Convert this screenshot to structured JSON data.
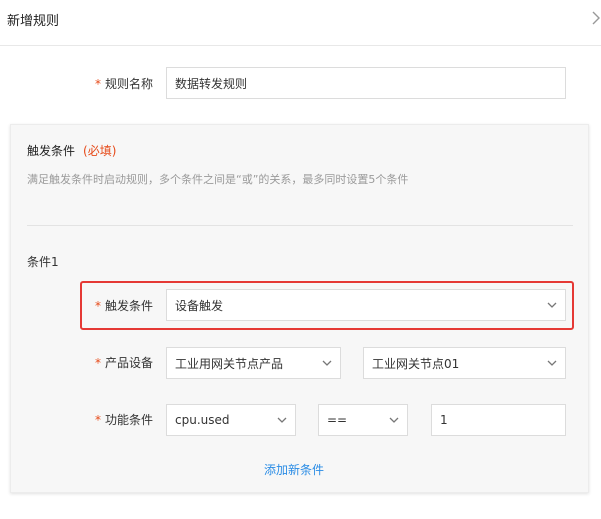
{
  "header": {
    "title": "新增规则"
  },
  "rule_name": {
    "label": "规则名称",
    "value": "数据转发规则",
    "required_mark": "*"
  },
  "trigger_section": {
    "title": "触发条件",
    "required_tag": "(必填)",
    "description": "满足触发条件时启动规则，多个条件之间是“或”的关系，最多同时设置5个条件"
  },
  "condition1": {
    "title": "条件1",
    "trigger": {
      "label": "触发条件",
      "value": "设备触发"
    },
    "product_device": {
      "label": "产品设备",
      "product_value": "工业用网关节点产品",
      "device_value": "工业网关节点01"
    },
    "function": {
      "label": "功能条件",
      "field_value": "cpu.used",
      "operator_value": "==",
      "compare_value": "1"
    }
  },
  "actions": {
    "add_condition": "添加新条件"
  },
  "colors": {
    "accent": "#2a8ce5",
    "required": "#e64a19",
    "highlight": "#e53935"
  }
}
